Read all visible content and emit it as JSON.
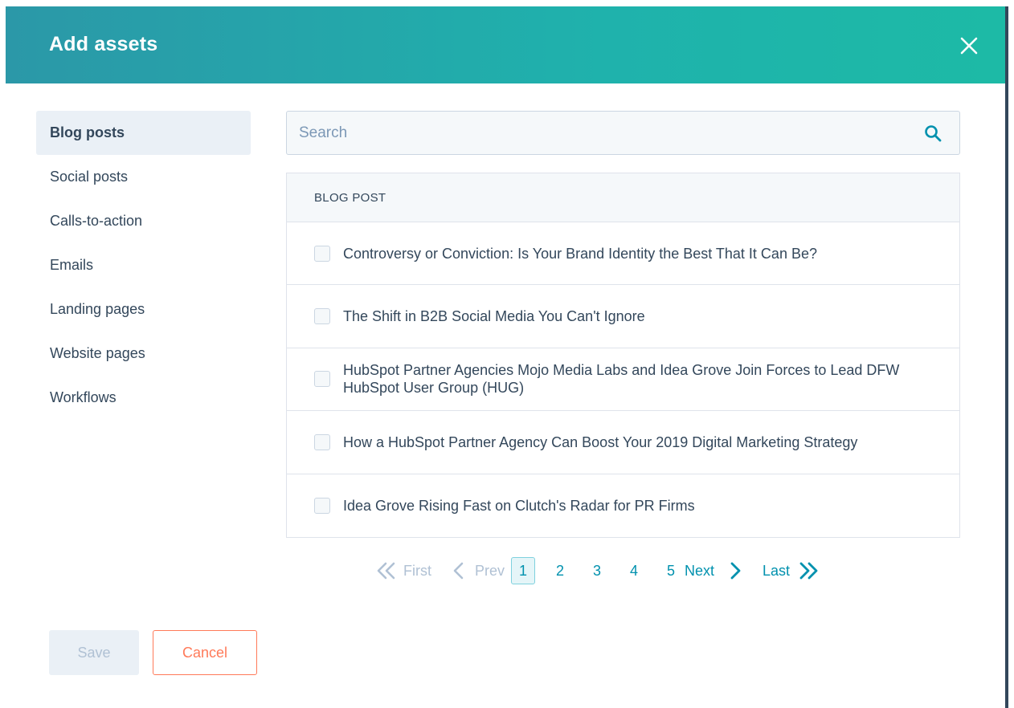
{
  "modal": {
    "title": "Add assets"
  },
  "sidebar": {
    "items": [
      {
        "label": "Blog posts",
        "active": true
      },
      {
        "label": "Social posts"
      },
      {
        "label": "Calls-to-action"
      },
      {
        "label": "Emails"
      },
      {
        "label": "Landing pages"
      },
      {
        "label": "Website pages"
      },
      {
        "label": "Workflows"
      }
    ]
  },
  "search": {
    "placeholder": "Search",
    "value": ""
  },
  "table": {
    "header": "BLOG POST",
    "rows": [
      {
        "title": "Controversy or Conviction: Is Your Brand Identity the Best That It Can Be?",
        "checked": false
      },
      {
        "title": "The Shift in B2B Social Media You Can't Ignore",
        "checked": false
      },
      {
        "title": "HubSpot Partner Agencies Mojo Media Labs and Idea Grove Join Forces to Lead DFW HubSpot User Group (HUG)",
        "checked": false
      },
      {
        "title": "How a HubSpot Partner Agency Can Boost Your 2019 Digital Marketing Strategy",
        "checked": false
      },
      {
        "title": "Idea Grove Rising Fast on Clutch's Radar for PR Firms",
        "checked": false
      }
    ]
  },
  "pagination": {
    "first": "First",
    "prev": "Prev",
    "pages": [
      "1",
      "2",
      "3",
      "4",
      "5"
    ],
    "current": "1",
    "next": "Next",
    "last": "Last"
  },
  "footer": {
    "save_label": "Save",
    "cancel_label": "Cancel"
  },
  "colors": {
    "header_gradient_start": "#2b98a8",
    "header_gradient_end": "#1dbaa6",
    "link": "#0091ae",
    "cancel": "#ff7a59"
  },
  "icons": {
    "close": "close-icon",
    "search": "search-icon",
    "first": "double-chevron-left-icon",
    "prev": "chevron-left-icon",
    "next": "chevron-right-icon",
    "last": "double-chevron-right-icon"
  }
}
